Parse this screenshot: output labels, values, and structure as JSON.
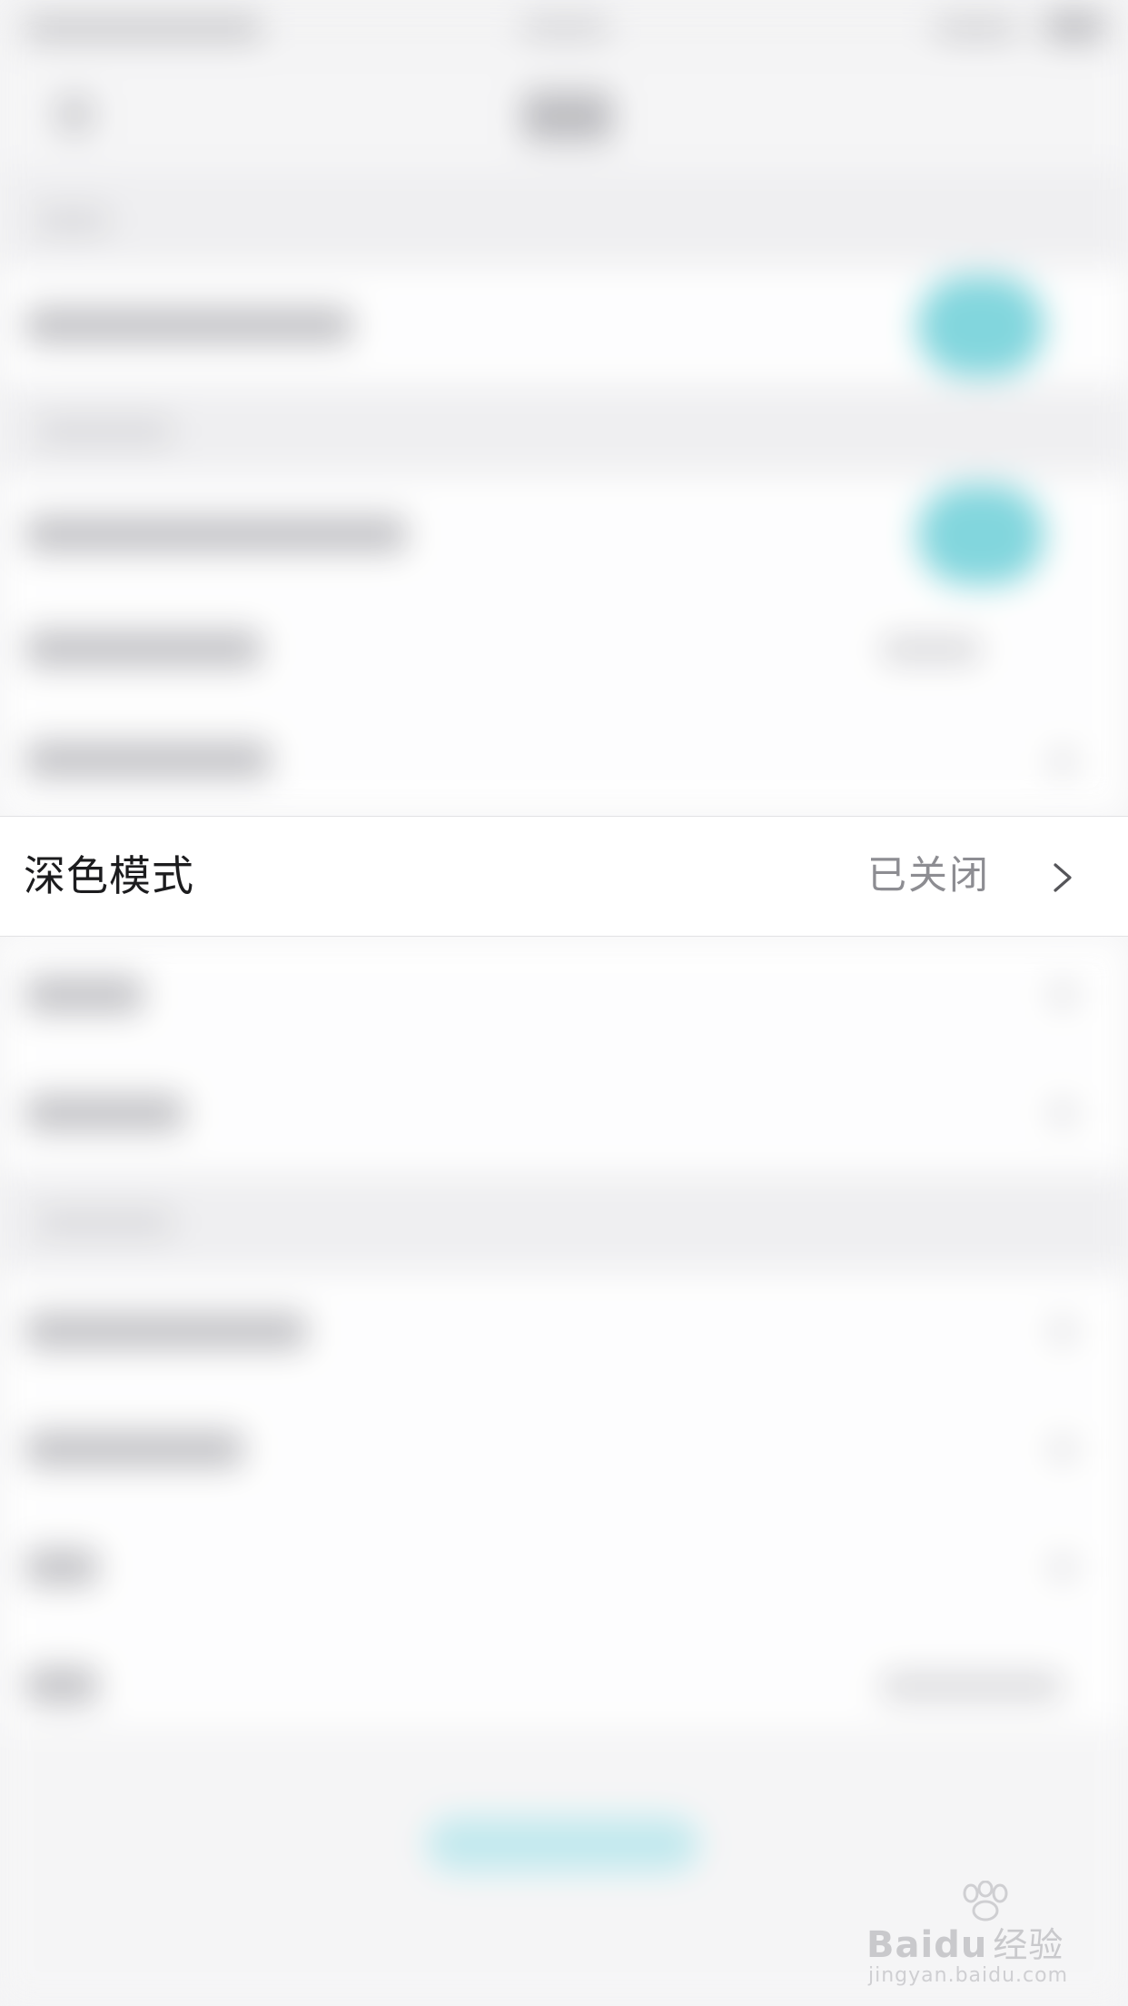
{
  "settings": {
    "dark_mode": {
      "label": "深色模式",
      "value": "已关闭"
    }
  },
  "watermark": {
    "brand_prefix": "Bai",
    "brand_suffix": "du",
    "brand_cn": "经验",
    "url": "jingyan.baidu.com"
  },
  "colors": {
    "toggle_accent": "#76d3db",
    "row_background": "#ffffff",
    "page_background": "#f4f4f5",
    "label_text": "#1c1c1e",
    "value_text": "#8d8d92"
  },
  "icons": {
    "row_chevron": "chevron-right-icon"
  }
}
